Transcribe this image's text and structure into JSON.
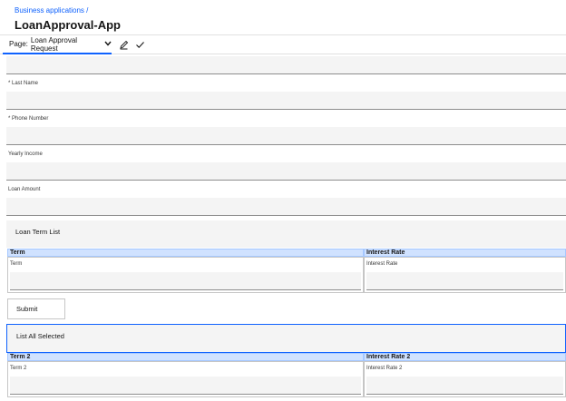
{
  "header": {
    "breadcrumb": "Business applications /",
    "title": "LoanApproval-App"
  },
  "toolbar": {
    "page_label": "Page:",
    "page_value": "Loan Approval Request",
    "edit_icon": "pencil-icon",
    "confirm_icon": "checkmark-icon"
  },
  "form": {
    "fields": [
      {
        "label": "* Last Name",
        "value": ""
      },
      {
        "label": "* Phone Number",
        "value": ""
      },
      {
        "label": "Yearly Income",
        "value": ""
      },
      {
        "label": "Loan Amount",
        "value": ""
      }
    ],
    "loan_term_list": {
      "title": "Loan Term List",
      "columns": [
        "Term",
        "Interest Rate"
      ],
      "cells": [
        "Term",
        "Interest Rate"
      ]
    },
    "submit_label": "Submit",
    "list_all_selected": {
      "title": "List All Selected",
      "columns": [
        "Term 2",
        "Interest Rate 2"
      ],
      "cells": [
        "Term 2",
        "Interest Rate 2"
      ]
    }
  },
  "colors": {
    "accent": "#0f62fe",
    "field_bg": "#f4f4f4",
    "table_header_bg": "#d0e2ff"
  }
}
